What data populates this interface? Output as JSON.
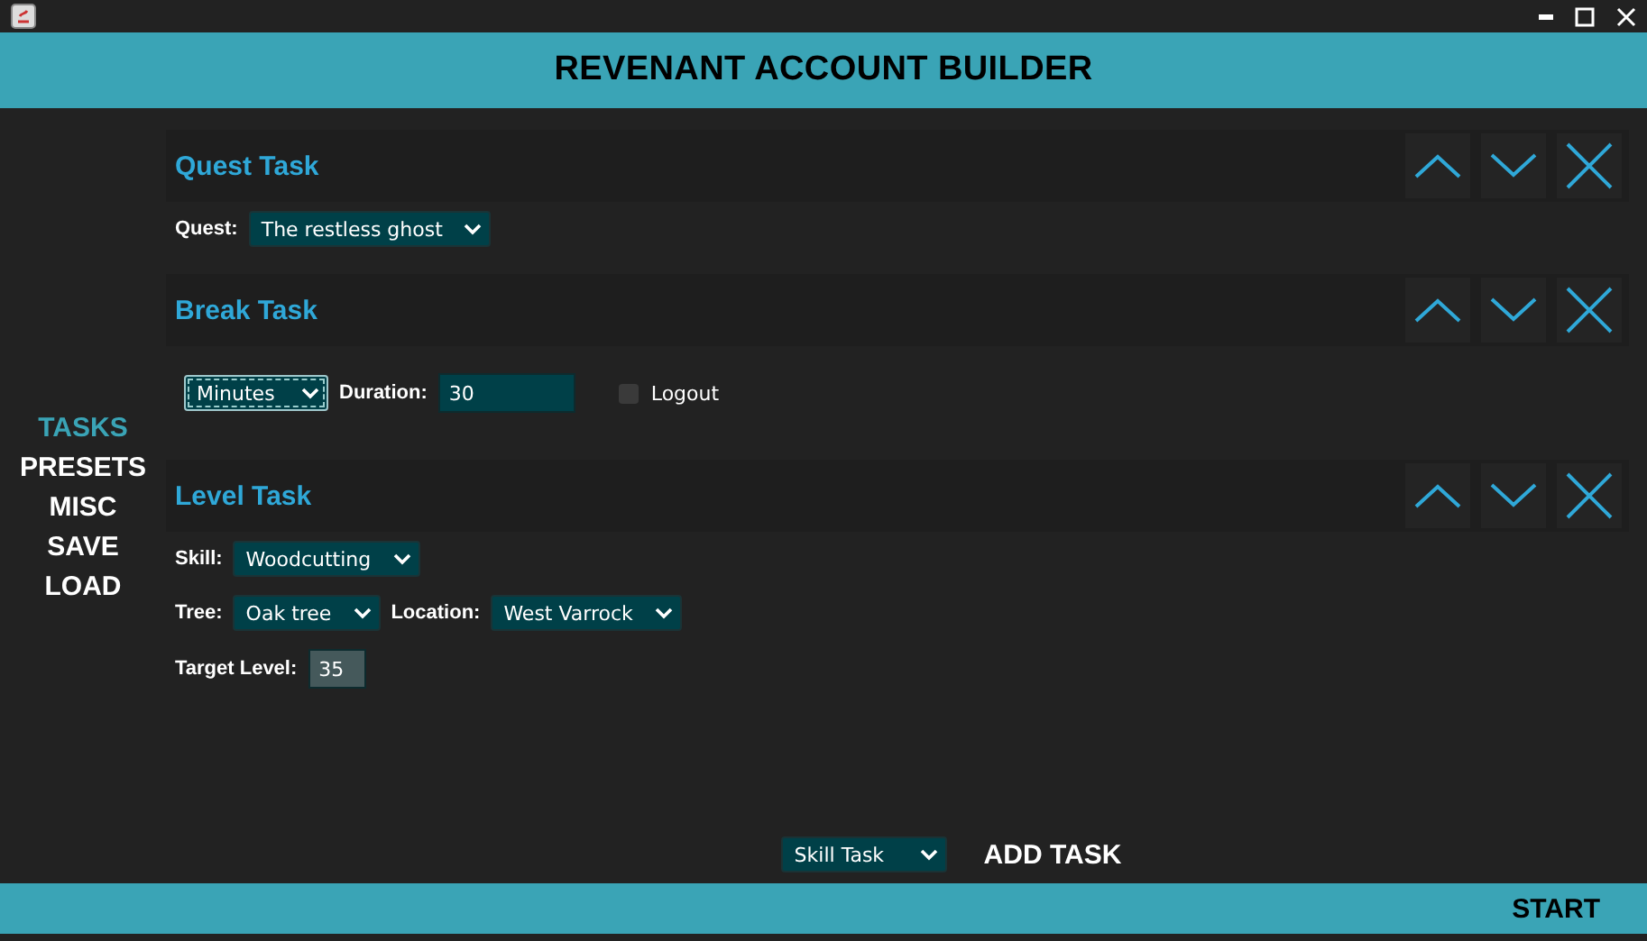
{
  "title": "REVENANT ACCOUNT BUILDER",
  "sidebar": {
    "items": [
      {
        "label": "TASKS",
        "selected": true
      },
      {
        "label": "PRESETS",
        "selected": false
      },
      {
        "label": "MISC",
        "selected": false
      },
      {
        "label": "SAVE",
        "selected": false
      },
      {
        "label": "LOAD",
        "selected": false
      }
    ]
  },
  "tasks": [
    {
      "title": "Quest Task",
      "spaced": false,
      "rows": [
        [
          {
            "kind": "select",
            "label": "Quest:",
            "value": "The restless ghost",
            "focused": false
          }
        ]
      ]
    },
    {
      "title": "Break Task",
      "spaced": true,
      "rows": [
        [
          {
            "kind": "select",
            "value": "Minutes",
            "focused": true
          },
          {
            "kind": "input",
            "label": "Duration:",
            "value": "30"
          },
          {
            "kind": "checkbox",
            "label": "Logout",
            "checked": false
          }
        ]
      ]
    },
    {
      "title": "Level Task",
      "spaced": false,
      "rows": [
        [
          {
            "kind": "select",
            "label": "Skill:",
            "value": "Woodcutting",
            "focused": false
          }
        ],
        [
          {
            "kind": "select",
            "label": "Tree:",
            "value": "Oak tree",
            "focused": false
          },
          {
            "kind": "select",
            "label": "Location:",
            "value": "West Varrock",
            "focused": false
          }
        ],
        [
          {
            "kind": "spinner",
            "label": "Target Level:",
            "value": "35"
          }
        ]
      ]
    }
  ],
  "add_task": {
    "type": "Skill Task",
    "button": "ADD TASK"
  },
  "footer": {
    "button": "START"
  }
}
